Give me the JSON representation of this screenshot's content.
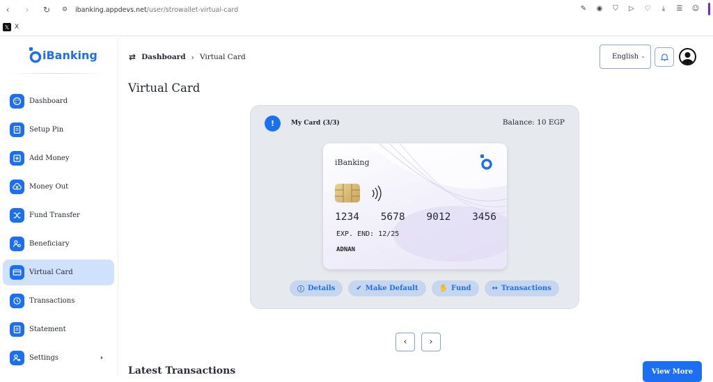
{
  "browser": {
    "url_host": "ibanking.appdevs.net",
    "url_path": "/user/strowallet-virtual-card",
    "bookmark_label": "X"
  },
  "brand": {
    "name": "iBanking",
    "color": "#1d6ff2"
  },
  "sidebar": {
    "items": [
      {
        "label": "Dashboard",
        "icon": "palette-icon"
      },
      {
        "label": "Setup Pin",
        "icon": "document-icon"
      },
      {
        "label": "Add Money",
        "icon": "plus-square-icon"
      },
      {
        "label": "Money Out",
        "icon": "cloud-upload-icon"
      },
      {
        "label": "Fund Transfer",
        "icon": "shuffle-icon"
      },
      {
        "label": "Beneficiary",
        "icon": "user-cog-icon"
      },
      {
        "label": "Virtual Card",
        "icon": "credit-card-icon",
        "active": true
      },
      {
        "label": "Transactions",
        "icon": "history-icon"
      },
      {
        "label": "Statement",
        "icon": "document-icon"
      },
      {
        "label": "Settings",
        "icon": "user-gear-icon",
        "has_submenu": true
      }
    ]
  },
  "header": {
    "breadcrumb_root": "Dashboard",
    "breadcrumb_current": "Virtual Card",
    "language": "English"
  },
  "page": {
    "title": "Virtual Card"
  },
  "card_panel": {
    "label": "My Card (3/3)",
    "balance": "Balance: 10 EGP",
    "card": {
      "brand": "iBanking",
      "number_groups": [
        "1234",
        "5678",
        "9012",
        "3456"
      ],
      "expiry": "EXP. END: 12/25",
      "holder": "ADNAN"
    },
    "actions": {
      "details": "Details",
      "make_default": "Make Default",
      "fund": "Fund",
      "transactions": "Transactions"
    }
  },
  "transactions": {
    "heading": "Latest Transactions",
    "view_more": "View More"
  }
}
